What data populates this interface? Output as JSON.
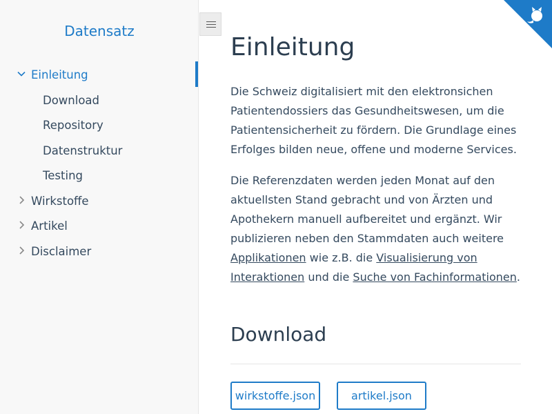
{
  "sidebar": {
    "app_name": "Datensatz",
    "items": [
      {
        "label": "Einleitung",
        "expanded": true,
        "active": true
      },
      {
        "label": "Download"
      },
      {
        "label": "Repository"
      },
      {
        "label": "Datenstruktur"
      },
      {
        "label": "Testing"
      },
      {
        "label": "Wirkstoffe",
        "expanded": false
      },
      {
        "label": "Artikel",
        "expanded": false
      },
      {
        "label": "Disclaimer",
        "expanded": false
      }
    ]
  },
  "toolbar": {
    "menu_icon": "hamburger-menu-icon"
  },
  "corner": {
    "icon": "github-octocat-icon",
    "color": "#1e7bc8"
  },
  "main": {
    "title": "Einleitung",
    "para1": "Die Schweiz digitalisiert mit den elektronsichen Patientendossiers das Gesundheitswesen, um die Patientensicherheit zu fördern. Die Grundlage eines Erfolges bilden neue, offene und moderne Services.",
    "para2": {
      "text1": "Die Referenzdaten werden jeden Monat auf den aktuellsten Stand gebracht und von Ärzten und Apothekern manuell aufbereitet und ergänzt. Wir publizieren neben den Stammdaten auch weitere ",
      "link1": "Applikationen",
      "text2": " wie z.B. die ",
      "link2": "Visualisierung von Interaktionen",
      "text3": " und die ",
      "link3": "Suche von Fachinformationen",
      "text4": "."
    },
    "download_heading": "Download",
    "buttons": [
      {
        "label": "wirkstoffe.json"
      },
      {
        "label": "artikel.json"
      }
    ]
  },
  "colors": {
    "accent": "#1e7bc8",
    "text": "#34495e",
    "sidebar_bg": "#f8f8f8"
  }
}
